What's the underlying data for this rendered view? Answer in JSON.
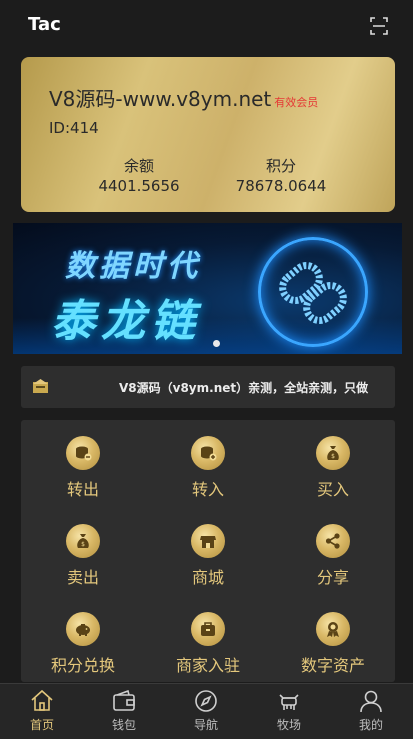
{
  "header": {
    "title": "Tac",
    "scan_icon": "scan-icon"
  },
  "account_card": {
    "site_name": "V8源码-www.v8ym.net",
    "badge": "有效会员",
    "user_id": "ID:414",
    "balance_label": "余额",
    "balance_value": "4401.5656",
    "points_label": "积分",
    "points_value": "78678.0644"
  },
  "banner": {
    "line1": "数据时代",
    "line2": "泰龙链",
    "slide_index": 1,
    "slide_count": 1
  },
  "notice": {
    "icon": "announcement-icon",
    "text": "V8源码（v8ym.net）亲测，全站亲测，只做"
  },
  "menu": [
    {
      "label": "转出",
      "icon": "coin-out-icon"
    },
    {
      "label": "转入",
      "icon": "coin-in-icon"
    },
    {
      "label": "买入",
      "icon": "money-bag-icon"
    },
    {
      "label": "卖出",
      "icon": "money-bag-sell-icon"
    },
    {
      "label": "商城",
      "icon": "shop-icon"
    },
    {
      "label": "分享",
      "icon": "share-icon"
    },
    {
      "label": "积分兑换",
      "icon": "piggy-bank-icon"
    },
    {
      "label": "商家入驻",
      "icon": "merchant-icon"
    },
    {
      "label": "数字资产",
      "icon": "medal-icon"
    }
  ],
  "tabbar": {
    "items": [
      {
        "label": "首页",
        "icon": "home-icon",
        "active": true
      },
      {
        "label": "钱包",
        "icon": "wallet-icon",
        "active": false
      },
      {
        "label": "导航",
        "icon": "compass-icon",
        "active": false
      },
      {
        "label": "牧场",
        "icon": "ranch-icon",
        "active": false
      },
      {
        "label": "我的",
        "icon": "user-icon",
        "active": false
      }
    ]
  },
  "colors": {
    "gold": "#e3c77c",
    "background": "#1c1c1c",
    "panel": "#2e2e2e",
    "badge_red": "#e53935"
  }
}
